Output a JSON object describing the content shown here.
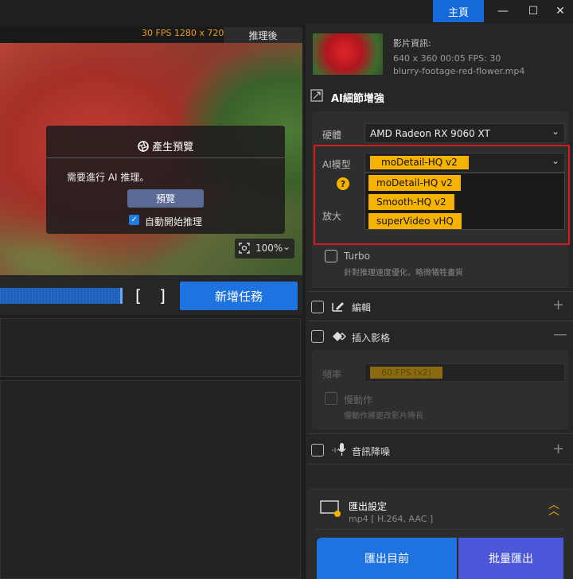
{
  "titlebar": {
    "home_label": "主頁",
    "minimize": "—",
    "maximize": "☐",
    "close": "✕"
  },
  "preview": {
    "fps_info": "30 FPS  1280 x 720",
    "tab_after": "推理後",
    "dialog": {
      "title": "產生預覽",
      "message": "需要進行 AI 推理。",
      "preview_button": "預覽",
      "auto_start_label": "自動開始推理",
      "auto_start_checked": true
    },
    "zoom": "100%"
  },
  "timeline": {
    "add_task_label": "新增任務"
  },
  "video_info": {
    "label": "影片資訊:",
    "specs": "640 x 360  00:05   FPS: 30",
    "filename": "blurry-footage-red-flower.mp4"
  },
  "ai_enhance": {
    "title": "AI細節增強",
    "hardware_label": "硬體",
    "hardware_value": "AMD Radeon RX 9060 XT",
    "model_label": "AI模型",
    "model_value": "moDetail-HQ  v2",
    "model_options": [
      "moDetail-HQ  v2",
      "Smooth-HQ  v2",
      "superVideo  vHQ"
    ],
    "scale_label": "放大",
    "turbo_label": "Turbo",
    "turbo_desc": "針對推理速度優化，略微犧牲畫質"
  },
  "edit": {
    "label": "編輯"
  },
  "interpolation": {
    "label": "插入影格",
    "rate_label": "頻率",
    "rate_value": "60 FPS (x2)",
    "slowmo_label": "慢動作",
    "slowmo_desc": "慢動作將更改影片時長"
  },
  "audio": {
    "label": "音訊降噪"
  },
  "export": {
    "title": "匯出設定",
    "format": "mp4 [ H.264, AAC ]",
    "export_current": "匯出目前",
    "batch_export": "批量匯出"
  },
  "colors": {
    "accent_blue": "#1e73e0",
    "highlight": "#f5b300",
    "alert_red": "#d11c24"
  }
}
